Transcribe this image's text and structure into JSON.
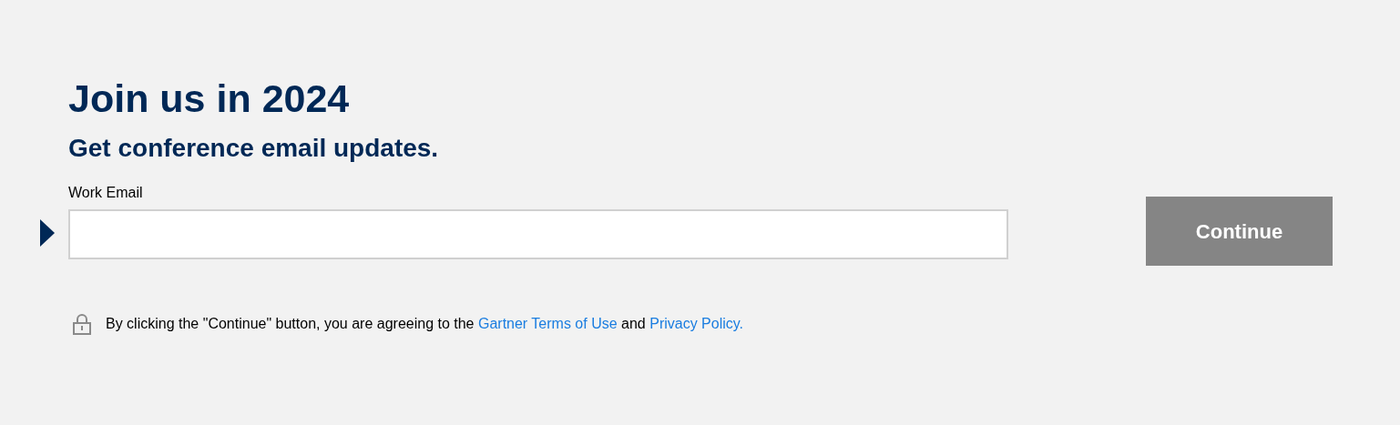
{
  "heading": "Join us in 2024",
  "subheading": "Get conference email updates.",
  "email_field": {
    "label": "Work Email"
  },
  "continue_button": {
    "label": "Continue"
  },
  "consent": [
    {
      "kind": "text",
      "text": "By clicking the \"Continue\" button, you are agreeing to the"
    },
    {
      "kind": "link",
      "text": "Gartner Terms of Use"
    },
    {
      "kind": "text",
      "text": "and"
    },
    {
      "kind": "link",
      "text": "Privacy Policy."
    }
  ]
}
